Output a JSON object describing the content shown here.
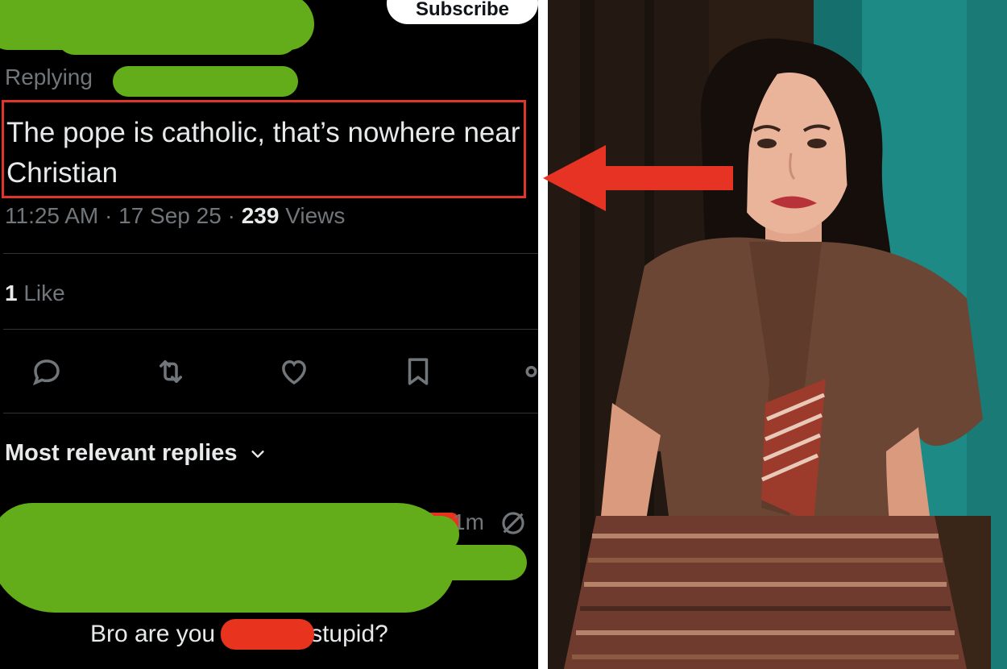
{
  "tweet": {
    "subscribe_label": "Subscribe",
    "replying_label": "Replying",
    "text": "The pope is catholic, that’s nowhere near Christian",
    "time": "11:25 AM",
    "date": "17 Sep 25",
    "separator": "·",
    "views_count": "239",
    "views_label": "Views",
    "likes_count": "1",
    "likes_label": "Like",
    "replies_header": "Most relevant replies",
    "reply": {
      "time": "1m",
      "text_before": "Bro are you",
      "text_after": "stupid?"
    }
  },
  "icons": [
    "reply-icon",
    "retweet-icon",
    "like-icon",
    "bookmark-icon",
    "share-icon",
    "grok-icon",
    "chevron-down-icon",
    "arrow-icon"
  ],
  "colors": {
    "highlight_box": "#e0352a",
    "scribble_green": "#63ad1a",
    "redaction_red": "#e8331f",
    "background": "#000000"
  }
}
